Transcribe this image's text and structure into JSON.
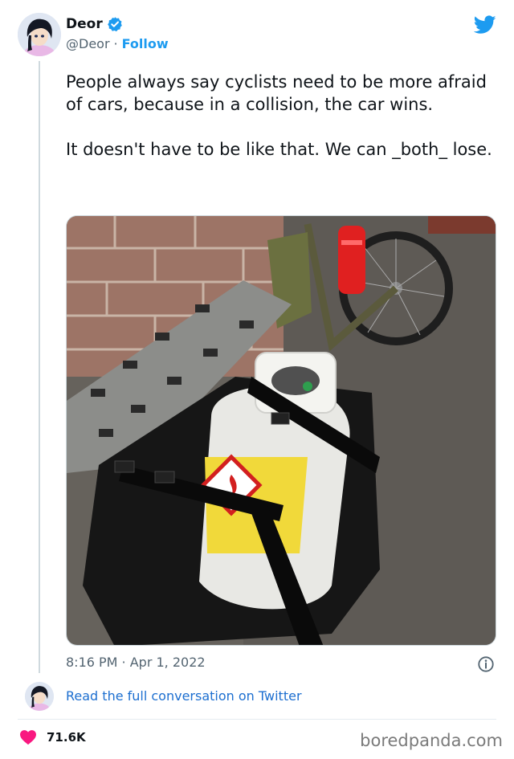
{
  "tweet": {
    "display_name": "Deor",
    "handle": "@Deor",
    "separator": "·",
    "follow_label": "Follow",
    "text": "People always say cyclists need to be more afraid of cars, because in a collision, the car wins.\n\nIt doesn't have to be like that. We can _both_ lose.",
    "timestamp": "8:16 PM · Apr 1, 2022",
    "read_conversation": "Read the full conversation on Twitter",
    "like_count": "71.6K"
  },
  "photo": {
    "label_warning": "FLAMMABLE"
  },
  "watermark": "boredpanda.com",
  "colors": {
    "accent": "#1d9bf0",
    "heart": "#f91880",
    "text": "#0f1419",
    "muted": "#536471"
  },
  "icons": [
    "verified-badge-icon",
    "twitter-bird-icon",
    "info-icon",
    "heart-icon"
  ]
}
